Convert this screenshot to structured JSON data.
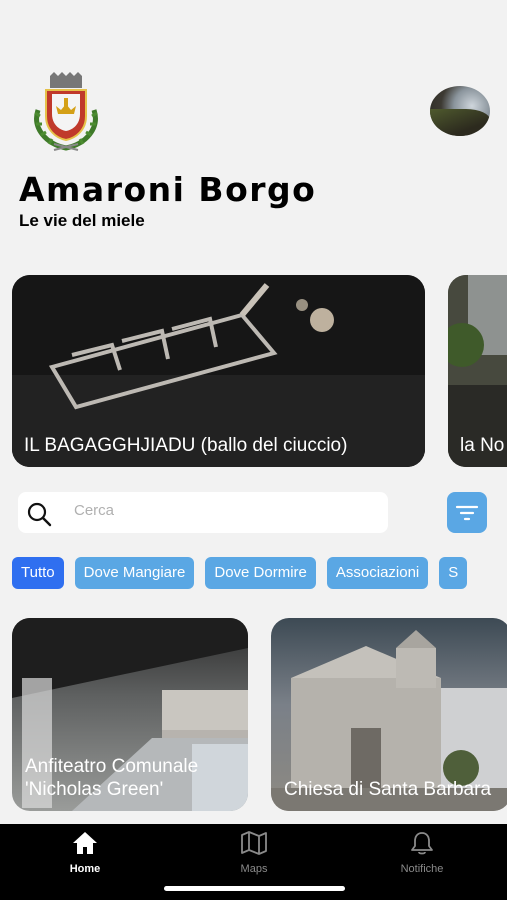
{
  "app": {
    "title": "Amaroni Borgo",
    "subtitle": "Le vie del miele",
    "logo_icon": "coat-of-arms-icon",
    "avatar_icon": "profile-photo"
  },
  "featured": [
    {
      "label": "IL BAGAGGHJIADU (ballo del ciuccio)"
    },
    {
      "label": "la No"
    }
  ],
  "search": {
    "placeholder": "Cerca",
    "icon": "search-icon",
    "filter_icon": "filter-icon"
  },
  "categories": [
    {
      "label": "Tutto",
      "active": true
    },
    {
      "label": "Dove Mangiare",
      "active": false
    },
    {
      "label": "Dove Dormire",
      "active": false
    },
    {
      "label": "Associazioni",
      "active": false
    },
    {
      "label": "S",
      "active": false
    }
  ],
  "places": [
    {
      "label": "Anfiteatro Comunale 'Nicholas Green'"
    },
    {
      "label": "Chiesa di Santa Barbara"
    }
  ],
  "tabbar": {
    "home": "Home",
    "maps": "Maps",
    "notifiche": "Notifiche"
  },
  "colors": {
    "background": "#f2f2f2",
    "chip": "#5aa7e4",
    "chip_active": "#2f6ff0",
    "tabbar": "#000000"
  }
}
